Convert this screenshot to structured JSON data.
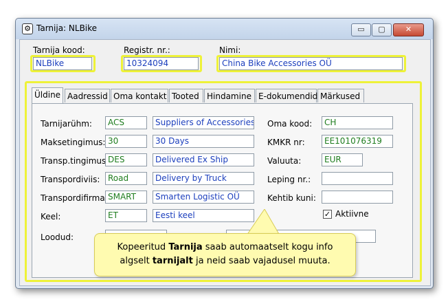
{
  "window": {
    "title": "Tarnija: NLBike",
    "buttons": {
      "minimize": "▭",
      "maximize": "▢",
      "close": "✕"
    }
  },
  "header": {
    "code_label": "Tarnija kood:",
    "code_value": "NLBike",
    "reg_label": "Registr. nr.:",
    "reg_value": "10324094",
    "name_label": "Nimi:",
    "name_value": "China Bike Accessories OÜ"
  },
  "tabs": [
    {
      "label": "Üldine"
    },
    {
      "label": "Aadressid"
    },
    {
      "label": "Oma kontakt"
    },
    {
      "label": "Tooted"
    },
    {
      "label": "Hindamine"
    },
    {
      "label": "E-dokumendid"
    },
    {
      "label": "Märkused"
    }
  ],
  "general": {
    "rows": [
      {
        "label": "Tarnijarühm:",
        "code": "ACS",
        "desc": "Suppliers of Accessories"
      },
      {
        "label": "Maksetingimus:",
        "code": "30",
        "desc": "30 Days"
      },
      {
        "label": "Transp.tingimus:",
        "code": "DES",
        "desc": "Delivered Ex Ship"
      },
      {
        "label": "Transpordiviis:",
        "code": "Road",
        "desc": "Delivery by Truck"
      },
      {
        "label": "Transpordifirma:",
        "code": "SMART",
        "desc": "Smarten Logistic OÜ"
      },
      {
        "label": "Keel:",
        "code": "ET",
        "desc": "Eesti keel"
      }
    ],
    "right": [
      {
        "label": "Oma kood:",
        "value": "CH"
      },
      {
        "label": "KMKR nr:",
        "value": "EE101076319"
      },
      {
        "label": "Valuuta:",
        "value": "EUR"
      },
      {
        "label": "Leping nr.:",
        "value": ""
      },
      {
        "label": "Kehtib kuni:",
        "value": ""
      }
    ],
    "active_label": "Aktiivne",
    "active_checked": "✓",
    "created_label": "Loodud:"
  },
  "callout": {
    "line1_a": "Kopeeritud ",
    "line1_b": "Tarnija",
    "line1_c": " saab automaatselt kogu info",
    "line2_a": "algselt ",
    "line2_b": "tarnijalt",
    "line2_c": " ja neid saab vajadusel muuta."
  },
  "colors": {
    "highlight": "#eef238",
    "callout_bg": "#fffbb0",
    "link_text": "#1c3fbd",
    "code_text": "#1f7d1f"
  }
}
